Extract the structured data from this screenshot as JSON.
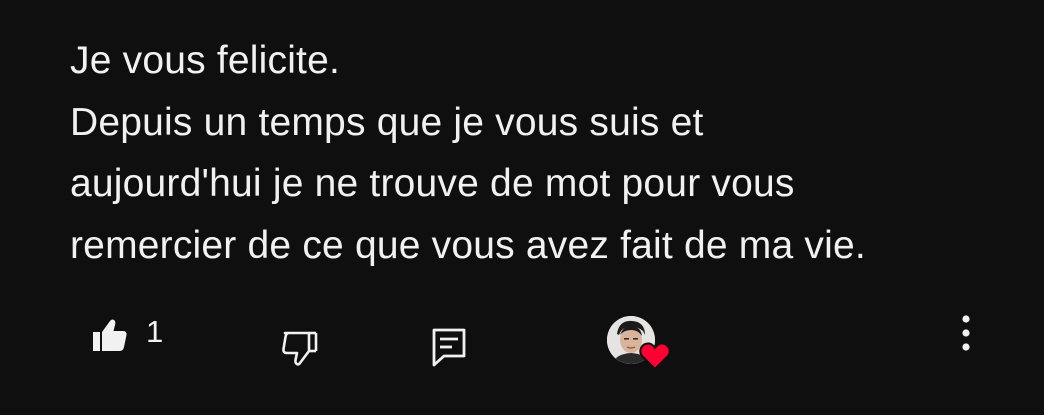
{
  "comment": {
    "lines": [
      "Je vous felicite.",
      "Depuis un temps que je vous suis et",
      "aujourd'hui je ne trouve de mot pour vous",
      "remercier de ce que vous avez fait de ma vie."
    ]
  },
  "actions": {
    "like_icon": "thumbs-up-icon",
    "like_count": "1",
    "dislike_icon": "thumbs-down-icon",
    "reply_icon": "reply-comment-icon",
    "creator_heart_icon": "heart-icon",
    "more_icon": "more-vertical-icon"
  },
  "colors": {
    "background": "#0f0f0f",
    "text": "#f1f1f1",
    "heart": "#ff0033"
  }
}
